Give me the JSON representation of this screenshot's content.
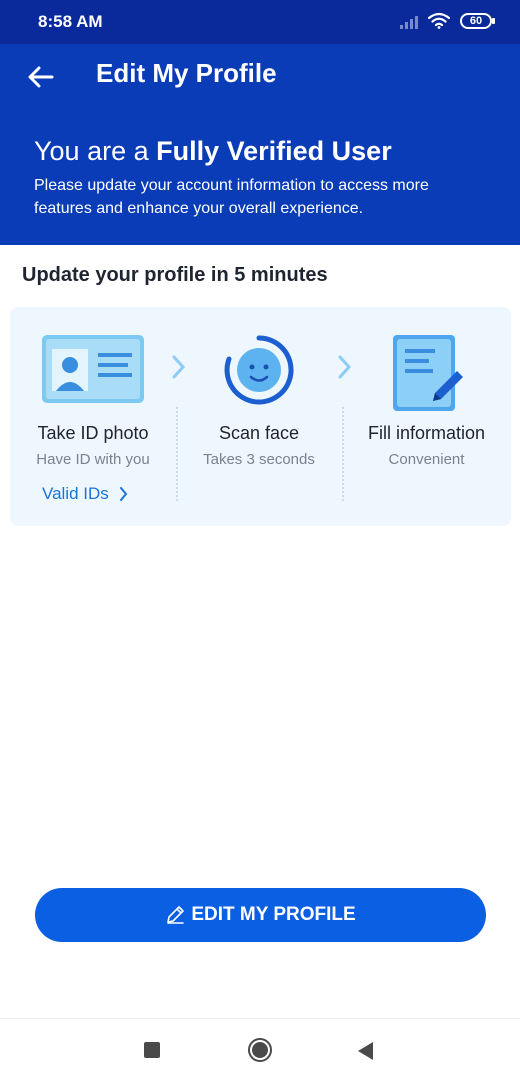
{
  "status_bar": {
    "time": "8:58 AM",
    "battery": "60",
    "icons": [
      "signal-icon",
      "wifi-icon",
      "battery-icon"
    ]
  },
  "header": {
    "back_icon": "arrow-left-icon",
    "title": "Edit My Profile",
    "verified_prefix": "You are a ",
    "verified_bold": "Fully Verified User",
    "description": "Please update your account information to access more features and enhance your overall experience."
  },
  "section": {
    "title": "Update your profile in 5 minutes"
  },
  "steps": [
    {
      "label": "Take ID photo",
      "subtitle": "Have ID with you",
      "icon": "id-card-icon",
      "link": "Valid IDs"
    },
    {
      "label": "Scan face",
      "subtitle": "Takes 3 seconds",
      "icon": "face-scan-icon"
    },
    {
      "label": "Fill information",
      "subtitle": "Convenient",
      "icon": "document-edit-icon"
    }
  ],
  "action": {
    "label": "EDIT MY PROFILE",
    "icon": "pencil-icon"
  },
  "nav": {
    "icons": [
      "recents-icon",
      "home-icon",
      "back-icon"
    ]
  },
  "colors": {
    "header_bg": "#0a3cb8",
    "status_bg": "#0a2a9c",
    "button_bg": "#0b5fe3",
    "link": "#1b73d8",
    "card_bg": "#eef6fe"
  }
}
